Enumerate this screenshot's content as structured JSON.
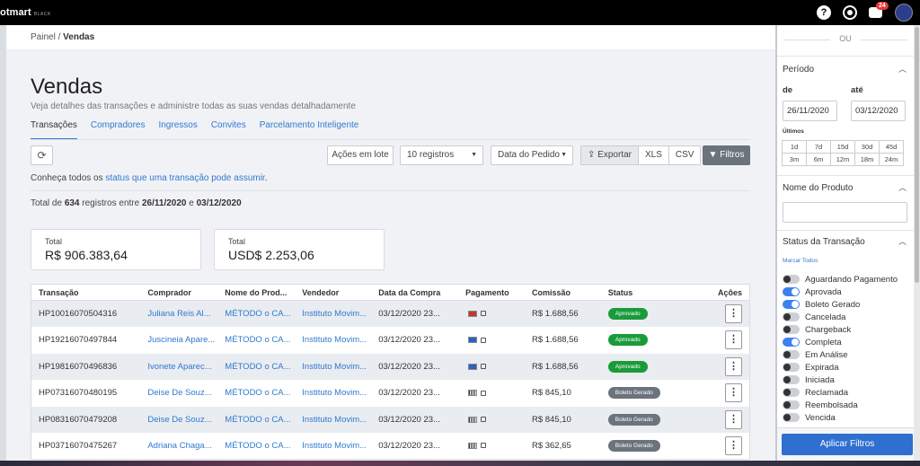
{
  "topbar": {
    "brand": "otmart",
    "brand_sub": "BLACK",
    "help_icon": "?",
    "notification_count": "24"
  },
  "breadcrumb": {
    "root": "Painel",
    "separator": "/",
    "current": "Vendas"
  },
  "page": {
    "title": "Vendas",
    "subtitle": "Veja detalhes das transações e administre todas as suas vendas detalhadamente"
  },
  "tabs": [
    "Transações",
    "Compradores",
    "Ingressos",
    "Convites",
    "Parcelamento Inteligente"
  ],
  "toolbar": {
    "batch_actions": "Ações em lote",
    "records": "10 registros",
    "order_date": "Data do Pedido",
    "export": "Exportar",
    "xls": "XLS",
    "csv": "CSV",
    "filters": "Filtros"
  },
  "status_info": {
    "prefix": "Conheça todos os ",
    "link": "status que uma transação pode assumir",
    "suffix": "."
  },
  "summary": {
    "prefix": "Total de ",
    "count": "634",
    "middle": " registros entre ",
    "start": "26/11/2020",
    "and": " e ",
    "end": "03/12/2020"
  },
  "cards": [
    {
      "label": "Total",
      "value": "R$ 906.383,64"
    },
    {
      "label": "Total",
      "value": "USD$ 2.253,06"
    }
  ],
  "table": {
    "headers": [
      "Transação",
      "Comprador",
      "Nome do Prod...",
      "Vendedor",
      "Data da Compra",
      "Pagamento",
      "Comissão",
      "Status",
      "Ações"
    ],
    "rows": [
      {
        "id": "HP10016070504316",
        "buyer": "Juliana Reis Al...",
        "product": "MÉTODO o CA...",
        "seller": "Instituto Movim...",
        "date": "03/12/2020 23...",
        "commission": "R$ 1.688,56",
        "status": "Aprovado",
        "kind": "ok",
        "pay": "card-red"
      },
      {
        "id": "HP19216070497844",
        "buyer": "Juscineia Apare...",
        "product": "MÉTODO o CA...",
        "seller": "Instituto Movim...",
        "date": "03/12/2020 23...",
        "commission": "R$ 1.688,56",
        "status": "Aprovado",
        "kind": "ok",
        "pay": "card-blue"
      },
      {
        "id": "HP19816070496836",
        "buyer": "Ivonete Aparec...",
        "product": "MÉTODO o CA...",
        "seller": "Instituto Movim...",
        "date": "03/12/2020 23...",
        "commission": "R$ 1.688,56",
        "status": "Aprovado",
        "kind": "ok",
        "pay": "card-blue"
      },
      {
        "id": "HP07316070480195",
        "buyer": "Deise De Souz...",
        "product": "MÉTODO o CA...",
        "seller": "Instituto Movim...",
        "date": "03/12/2020 23...",
        "commission": "R$ 845,10",
        "status": "Boleto Gerado",
        "kind": "boleto",
        "pay": "boleto"
      },
      {
        "id": "HP08316070479208",
        "buyer": "Deise De Souz...",
        "product": "MÉTODO o CA...",
        "seller": "Instituto Movim...",
        "date": "03/12/2020 23...",
        "commission": "R$ 845,10",
        "status": "Boleto Gerado",
        "kind": "boleto",
        "pay": "boleto"
      },
      {
        "id": "HP03716070475267",
        "buyer": "Adriana Chaga...",
        "product": "MÉTODO o CA...",
        "seller": "Instituto Movim...",
        "date": "03/12/2020 23...",
        "commission": "R$ 362,65",
        "status": "Boleto Gerado",
        "kind": "boleto",
        "pay": "boleto"
      }
    ]
  },
  "sidebar": {
    "ou": "OU",
    "period_title": "Período",
    "from_label": "de",
    "to_label": "até",
    "from_value": "26/11/2020",
    "to_value": "03/12/2020",
    "ultimos": "Últimos",
    "ranges": [
      "1d",
      "7d",
      "15d",
      "30d",
      "45d",
      "3m",
      "6m",
      "12m",
      "18m",
      "24m"
    ],
    "product_title": "Nome do Produto",
    "product_value": "",
    "status_title": "Status da Transação",
    "mark_all": "Marcar Todos",
    "statuses": [
      {
        "label": "Aguardando Pagamento",
        "on": false
      },
      {
        "label": "Aprovada",
        "on": true
      },
      {
        "label": "Boleto Gerado",
        "on": true
      },
      {
        "label": "Cancelada",
        "on": false
      },
      {
        "label": "Chargeback",
        "on": false
      },
      {
        "label": "Completa",
        "on": true
      },
      {
        "label": "Em Análise",
        "on": false
      },
      {
        "label": "Expirada",
        "on": false
      },
      {
        "label": "Iniciada",
        "on": false
      },
      {
        "label": "Reclamada",
        "on": false
      },
      {
        "label": "Reembolsada",
        "on": false
      },
      {
        "label": "Vencida",
        "on": false
      }
    ],
    "apply": "Aplicar Filtros"
  },
  "colors": {
    "accent": "#2f79d0",
    "approved": "#1a9b3a",
    "boleto": "#6b737c",
    "apply": "#2f6fd0"
  }
}
